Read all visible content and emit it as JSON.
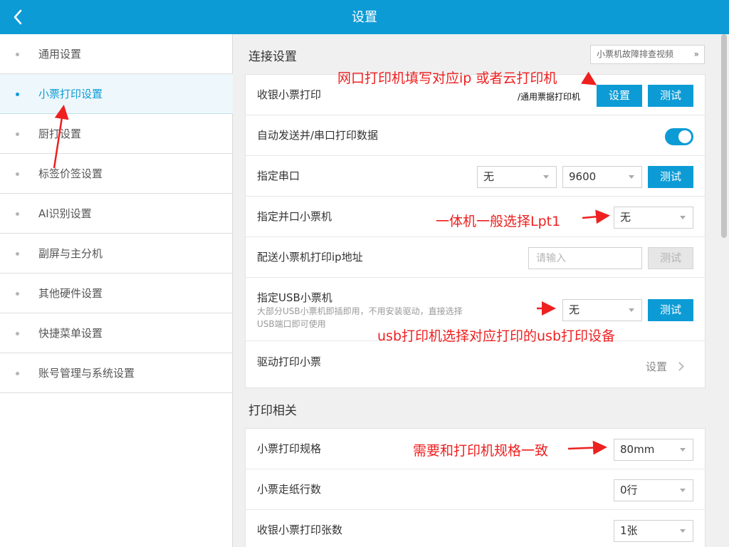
{
  "header": {
    "title": "设置"
  },
  "sidebar": {
    "items": [
      {
        "label": "通用设置",
        "active": false
      },
      {
        "label": "小票打印设置",
        "active": true
      },
      {
        "label": "厨打设置",
        "active": false
      },
      {
        "label": "标签价签设置",
        "active": false
      },
      {
        "label": "AI识别设置",
        "active": false
      },
      {
        "label": "副屏与主分机",
        "active": false
      },
      {
        "label": "其他硬件设置",
        "active": false
      },
      {
        "label": "快捷菜单设置",
        "active": false
      },
      {
        "label": "账号管理与系统设置",
        "active": false
      }
    ]
  },
  "connection": {
    "title": "连接设置",
    "video_button": "小票机故障排查视频",
    "cashier_print": {
      "label": "收银小票打印",
      "note": "/通用票据打印机",
      "set_button": "设置",
      "test_button": "测试"
    },
    "auto_send": {
      "label": "自动发送并/串口打印数据",
      "enabled": true
    },
    "serial_port": {
      "label": "指定串口",
      "port_value": "无",
      "baud_value": "9600",
      "test_button": "测试"
    },
    "parallel": {
      "label": "指定并口小票机",
      "value": "无"
    },
    "delivery_ip": {
      "label": "配送小票机打印ip地址",
      "placeholder": "请输入",
      "test_button": "测试"
    },
    "usb": {
      "label": "指定USB小票机",
      "sub": "大部分USB小票机即插即用，不用安装驱动，直接选择USB端口即可使用",
      "value": "无",
      "test_button": "测试"
    },
    "driver": {
      "label": "驱动打印小票",
      "link": "设置"
    }
  },
  "print": {
    "title": "打印相关",
    "spec": {
      "label": "小票打印规格",
      "value": "80mm"
    },
    "feed": {
      "label": "小票走纸行数",
      "value": "0行"
    },
    "copies": {
      "label": "收银小票打印张数",
      "value": "1张"
    }
  },
  "annotations": {
    "network_printer": "网口打印机填写对应ip 或者云打印机",
    "parallel_hint": "一体机一般选择Lpt1",
    "usb_hint": "usb打印机选择对应打印的usb打印设备",
    "spec_hint": "需要和打印机规格一致"
  },
  "colors": {
    "accent": "#0d9bd6",
    "annotation": "#ee2020"
  }
}
